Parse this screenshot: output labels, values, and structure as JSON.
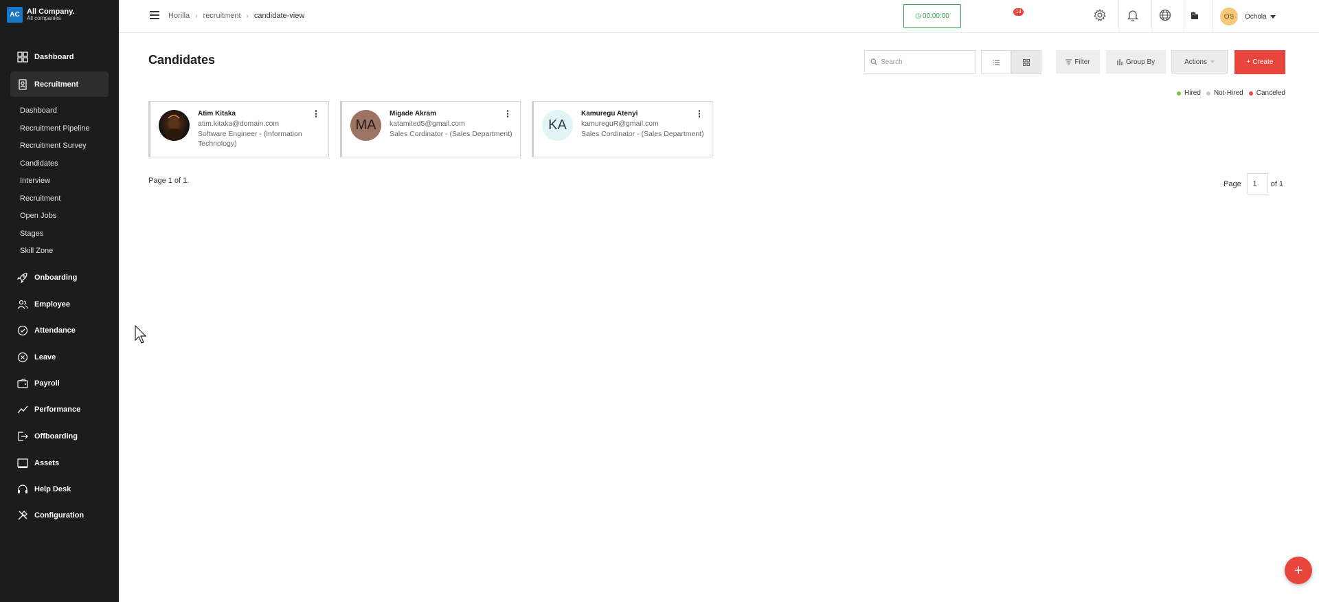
{
  "company": {
    "logo": "AC",
    "name": "All Company.",
    "sub": "All companies"
  },
  "sidebar": {
    "items": [
      {
        "label": "Dashboard",
        "icon": "dashboard-icon"
      },
      {
        "label": "Recruitment",
        "icon": "recruitment-icon",
        "active": true
      },
      {
        "label": "Onboarding",
        "icon": "rocket-icon"
      },
      {
        "label": "Employee",
        "icon": "people-icon"
      },
      {
        "label": "Attendance",
        "icon": "check-circle-icon"
      },
      {
        "label": "Leave",
        "icon": "x-circle-icon"
      },
      {
        "label": "Payroll",
        "icon": "wallet-icon"
      },
      {
        "label": "Performance",
        "icon": "trend-icon"
      },
      {
        "label": "Offboarding",
        "icon": "exit-icon"
      },
      {
        "label": "Assets",
        "icon": "laptop-icon"
      },
      {
        "label": "Help Desk",
        "icon": "headset-icon"
      },
      {
        "label": "Configuration",
        "icon": "tools-icon"
      }
    ],
    "recruitment_sub": [
      "Dashboard",
      "Recruitment Pipeline",
      "Recruitment Survey",
      "Candidates",
      "Interview",
      "Recruitment",
      "Open Jobs",
      "Stages",
      "Skill Zone"
    ]
  },
  "topbar": {
    "breadcrumb": [
      "Horilla",
      "recruitment",
      "candidate-view"
    ],
    "timer": "00:00:00",
    "notification_count": "13",
    "user": {
      "initials": "OS",
      "name": "Ochola"
    }
  },
  "main": {
    "title": "Candidates",
    "search_placeholder": "Search",
    "filter_label": "Filter",
    "group_by_label": "Group By",
    "actions_label": "Actions",
    "create_label": "+ Create",
    "legend": [
      {
        "label": "Hired",
        "color": "#7cc242"
      },
      {
        "label": "Not-Hired",
        "color": "#c8c8c8"
      },
      {
        "label": "Canceled",
        "color": "#e8453c"
      }
    ],
    "candidates": [
      {
        "name": "Atim Kitaka",
        "email": "atim.kitaka@domain.com",
        "job": "Software Engineer - (Information Technology)",
        "initials": "",
        "avatar_type": "photo"
      },
      {
        "name": "Migade Akram",
        "email": "katamited5@gmail.com",
        "job": "Sales Cordinator - (Sales Department)",
        "initials": "MA",
        "avatar_bg": "#9c7466",
        "avatar_fg": "#2a1a14"
      },
      {
        "name": "Kamuregu Atenyi",
        "email": "kamureguR@gmail.com",
        "job": "Sales Cordinator - (Sales Department)",
        "initials": "KA",
        "avatar_bg": "#e3f4f7",
        "avatar_fg": "#2a3a3e"
      }
    ],
    "page_info": "Page 1 of 1.",
    "pager": {
      "label": "Page",
      "current": "1",
      "of_label": "of 1"
    }
  }
}
